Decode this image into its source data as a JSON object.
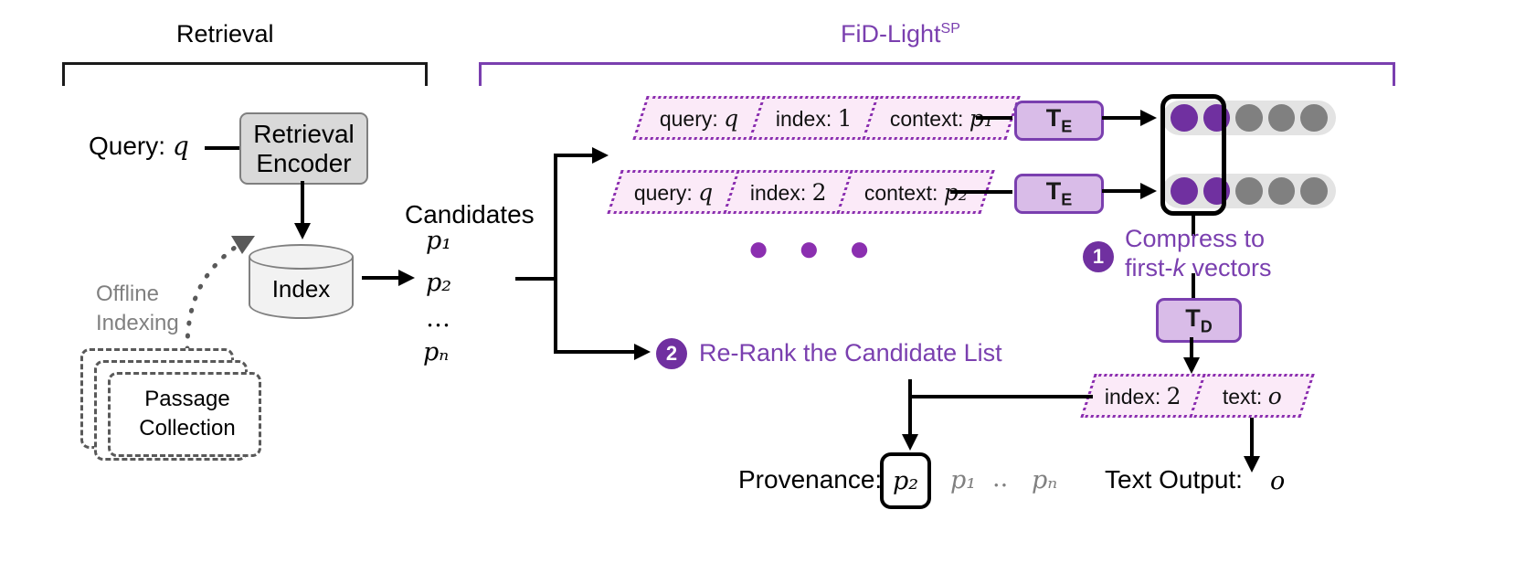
{
  "sections": {
    "retrieval": {
      "title": "Retrieval"
    },
    "fidlight": {
      "title": "FiD-Light",
      "superscript": "SP"
    }
  },
  "left": {
    "query_label": "Query:",
    "query_symbol": "q",
    "encoder_line1": "Retrieval",
    "encoder_line2": "Encoder",
    "index_label": "Index",
    "offline_line1": "Offline",
    "offline_line2": "Indexing",
    "passage_line1": "Passage",
    "passage_line2": "Collection",
    "candidates_label": "Candidates",
    "candidates": [
      "p₁",
      "p₂",
      "…",
      "pₙ"
    ]
  },
  "inputs": {
    "rows": [
      {
        "query": "query:",
        "query_val": "q",
        "index": "index:",
        "index_val": "1",
        "context": "context:",
        "context_val": "p₁"
      },
      {
        "query": "query:",
        "query_val": "q",
        "index": "index:",
        "index_val": "2",
        "context": "context:",
        "context_val": "p₂"
      }
    ],
    "ellipsis": "● ● ●"
  },
  "encoders": {
    "te_label": "T",
    "te_sub": "E",
    "td_label": "T",
    "td_sub": "D"
  },
  "vectors": {
    "rows": [
      {
        "colors": [
          "purple",
          "purple",
          "gray",
          "gray",
          "gray"
        ]
      },
      {
        "colors": [
          "purple",
          "purple",
          "gray",
          "gray",
          "gray"
        ]
      }
    ]
  },
  "steps": [
    {
      "number": "1",
      "line1": "Compress to",
      "line2_pre": "first-",
      "line2_em": "k",
      "line2_post": " vectors"
    },
    {
      "number": "2",
      "text": "Re-Rank the Candidate List"
    }
  ],
  "output": {
    "chip_index_label": "index:",
    "chip_index_val": "2",
    "chip_text_label": "text:",
    "chip_text_val": "o",
    "provenance_label": "Provenance:",
    "provenance_selected": "p₂",
    "provenance_rest": [
      "p₁",
      "..",
      "pₙ"
    ],
    "text_output_label": "Text Output:",
    "text_output_val": "o"
  },
  "colors": {
    "purple_accent": "#7a3faf",
    "purple_dot": "#7030a0",
    "chip_fill": "#fbeaf8",
    "chip_border": "#8b2fb0",
    "tbox_fill": "#d9bce8",
    "gray_box": "#d9d9d9",
    "gray_dot": "#808080",
    "vector_track": "#e3e3e3"
  }
}
